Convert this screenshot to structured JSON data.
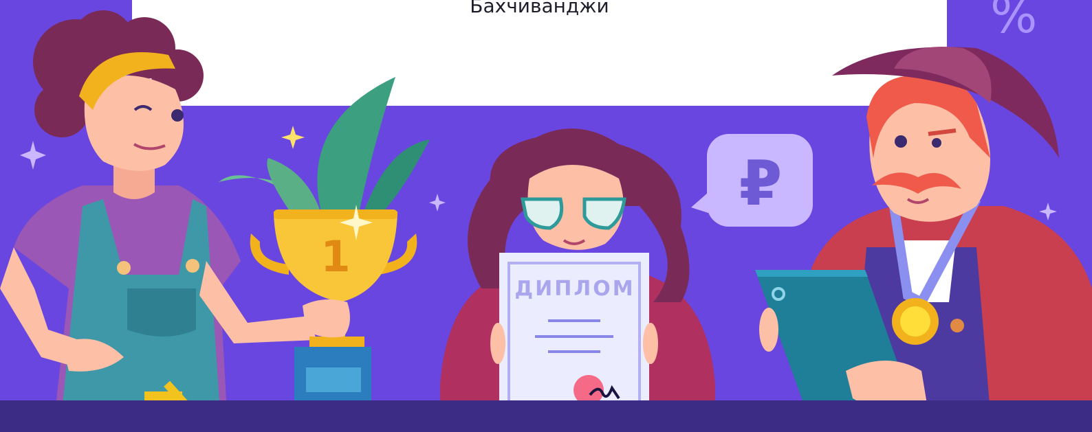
{
  "banner": {
    "name_text": "Бахчиванджи",
    "percent_symbol": "%"
  },
  "speech_bubble": {
    "symbol": "₽"
  },
  "trophy": {
    "number": "1"
  },
  "diploma": {
    "title": "ДИПЛОМ"
  },
  "colors": {
    "background": "#6a46e0",
    "floor": "#3c2c86",
    "panel": "#ffffff",
    "accent_light": "#b7a2ff"
  }
}
